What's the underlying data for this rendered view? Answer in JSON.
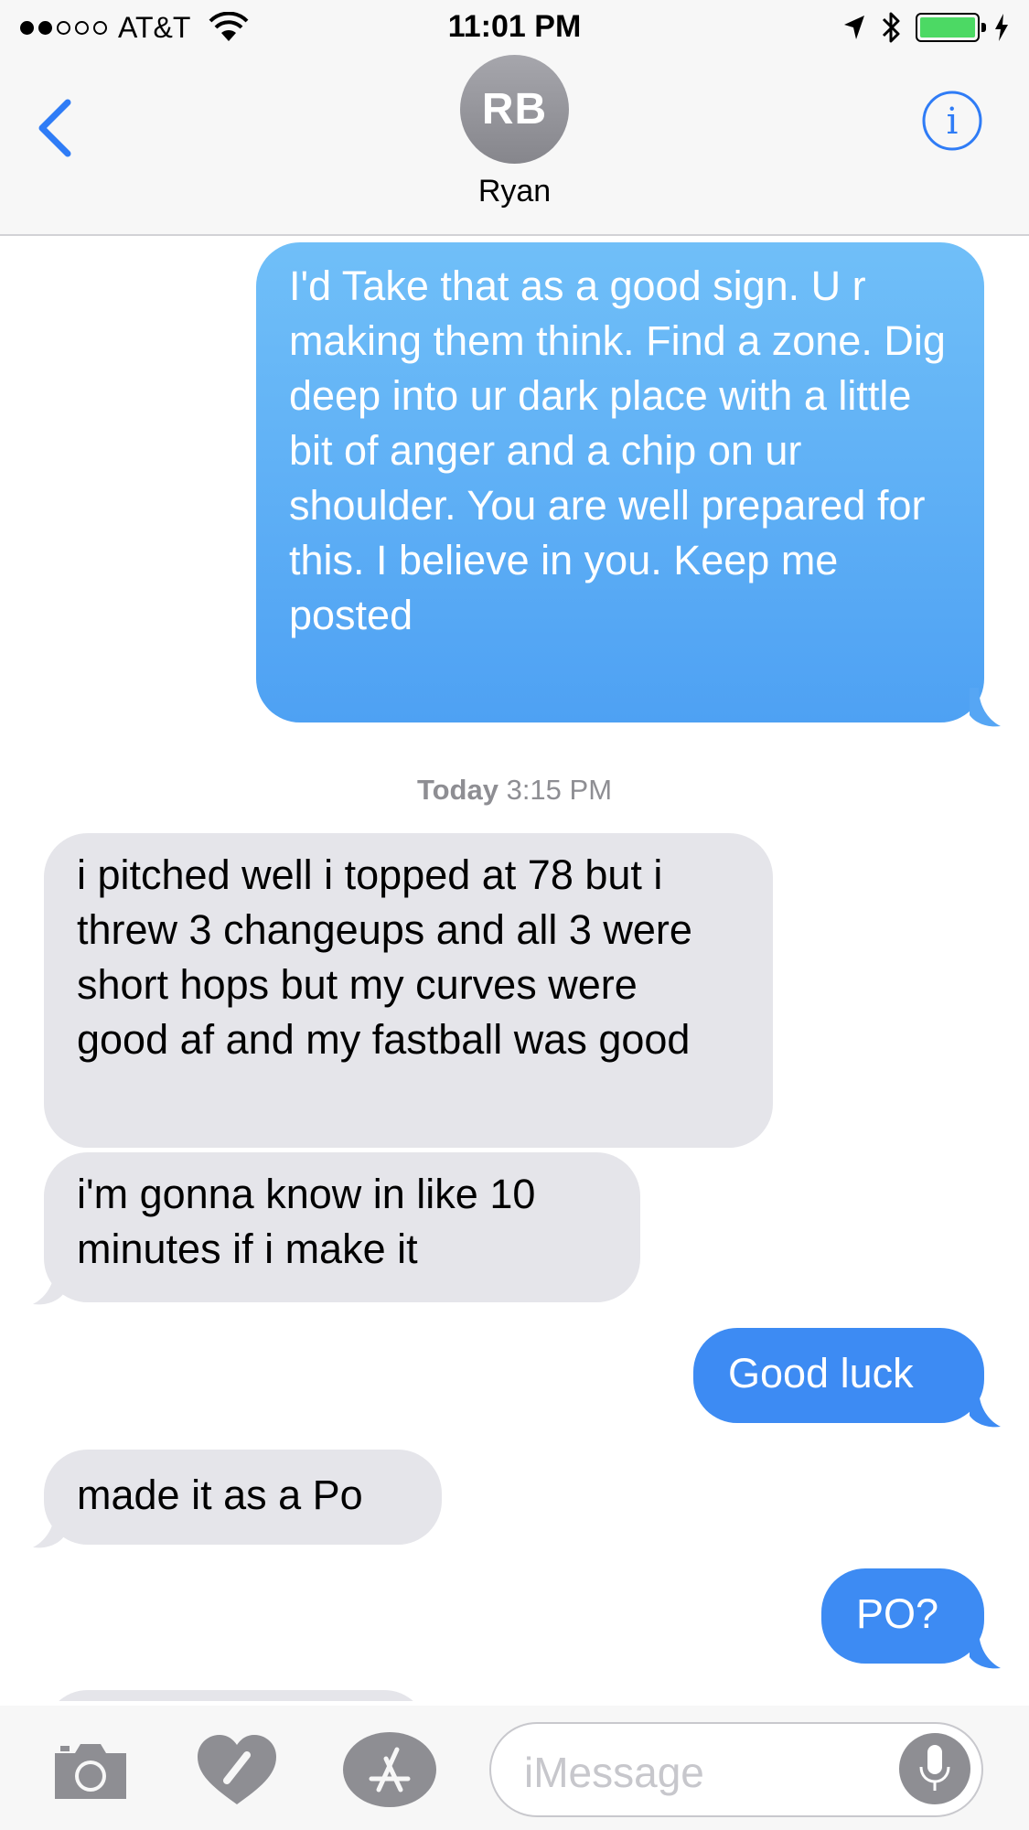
{
  "status_bar": {
    "carrier": "AT&T",
    "time": "11:01 PM",
    "battery_level": 1.0,
    "signal_bars_filled": 2,
    "signal_bars_total": 5
  },
  "header": {
    "avatar_initials": "RB",
    "contact_name": "Ryan"
  },
  "messages": [
    {
      "direction": "outgoing",
      "text": "I'd Take that as a good sign. U r making them think. Find a zone. Dig deep into ur dark place with a little bit of anger and a chip on ur shoulder. You are well prepared for this. I believe in you.  Keep me posted"
    },
    {
      "direction": "incoming",
      "text": "i pitched well i topped at 78 but i threw 3 changeups and all 3 were short hops but my curves were good af and my fastball was good"
    },
    {
      "direction": "incoming",
      "text": "i'm gonna know in like 10 minutes if i make it"
    },
    {
      "direction": "outgoing",
      "text": "Good luck"
    },
    {
      "direction": "incoming",
      "text": "made it as a Po"
    },
    {
      "direction": "outgoing",
      "text": "PO?"
    }
  ],
  "timestamp": {
    "day": "Today",
    "time": "3:15 PM"
  },
  "input": {
    "placeholder": "iMessage"
  },
  "colors": {
    "outgoing_bubble": "#3d8bf3",
    "incoming_bubble": "#e5e5ea",
    "accent": "#2f7cf6",
    "battery": "#4cd964"
  },
  "icons": [
    "back-chevron-icon",
    "info-icon",
    "camera-icon",
    "digital-touch-icon",
    "app-store-icon",
    "microphone-icon",
    "wifi-icon",
    "location-arrow-icon",
    "bluetooth-icon",
    "charging-bolt-icon"
  ]
}
